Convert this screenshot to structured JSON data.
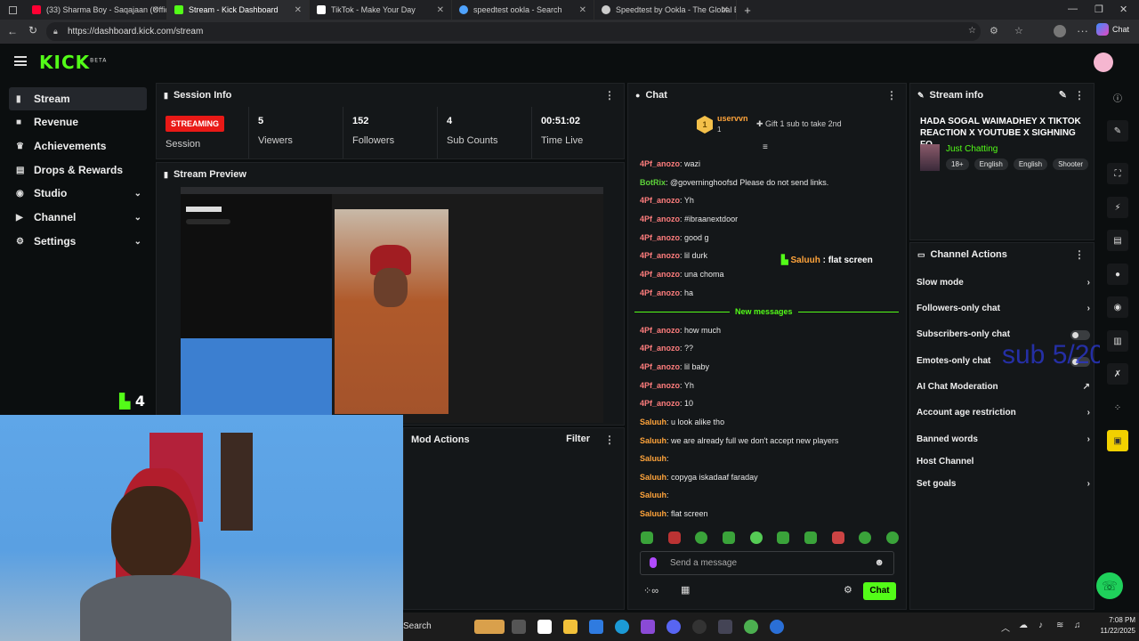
{
  "browser": {
    "tabs": [
      {
        "title": "(33) Sharma Boy - Saqajaan (Offic",
        "color": "#ff0033"
      },
      {
        "title": "Stream - Kick Dashboard",
        "color": "#53fc18"
      },
      {
        "title": "TikTok - Make Your Day",
        "color": "#ffffff"
      },
      {
        "title": "speedtest ookla - Search",
        "color": "#4fa3ff"
      },
      {
        "title": "Speedtest by Ookla - The Global B",
        "color": "#cccccc"
      }
    ],
    "url": "https://dashboard.kick.com/stream",
    "chat_button": "Chat"
  },
  "app": {
    "logo": "KICK",
    "logo_beta": "BETA"
  },
  "sidebar": {
    "items": [
      {
        "label": "Stream"
      },
      {
        "label": "Revenue"
      },
      {
        "label": "Achievements"
      },
      {
        "label": "Drops & Rewards"
      },
      {
        "label": "Studio"
      },
      {
        "label": "Channel"
      },
      {
        "label": "Settings"
      }
    ]
  },
  "session": {
    "title": "Session Info",
    "status": "STREAMING",
    "status_label": "Session",
    "stats": [
      {
        "value": "5",
        "label": "Viewers"
      },
      {
        "value": "152",
        "label": "Followers"
      },
      {
        "value": "4",
        "label": "Sub Counts"
      },
      {
        "value": "00:51:02",
        "label": "Time Live"
      }
    ]
  },
  "preview": {
    "title": "Stream Preview",
    "overlay_count": "4"
  },
  "mod": {
    "title": "Mod Actions",
    "filter": "Filter"
  },
  "chat": {
    "title": "Chat",
    "top_user": "uservvn",
    "top_user_count": "1",
    "gift_text": "Gift 1 sub to take 2nd",
    "messages": [
      {
        "user": "4Pf_anozo",
        "text": "wazi",
        "cls": "u1"
      },
      {
        "user": "BotRix",
        "text": "@governinghoofsd Please do not send links.",
        "cls": "u3"
      },
      {
        "user": "4Pf_anozo",
        "text": "Yh",
        "cls": "u1"
      },
      {
        "user": "4Pf_anozo",
        "text": "#ibraanextdoor",
        "cls": "u1"
      },
      {
        "user": "4Pf_anozo",
        "text": "good g",
        "cls": "u1"
      },
      {
        "user": "4Pf_anozo",
        "text": "lil durk",
        "cls": "u1"
      },
      {
        "user": "4Pf_anozo",
        "text": "una choma",
        "cls": "u1"
      },
      {
        "user": "4Pf_anozo",
        "text": "ha",
        "cls": "u1"
      }
    ],
    "new_messages_label": "New messages",
    "messages2": [
      {
        "user": "4Pf_anozo",
        "text": "how much",
        "cls": "u1"
      },
      {
        "user": "4Pf_anozo",
        "text": "??",
        "cls": "u1"
      },
      {
        "user": "4Pf_anozo",
        "text": "lil baby",
        "cls": "u1"
      },
      {
        "user": "4Pf_anozo",
        "text": "Yh",
        "cls": "u1"
      },
      {
        "user": "4Pf_anozo",
        "text": "10",
        "cls": "u1"
      },
      {
        "user": "Saluuh",
        "text": "u look alike tho",
        "cls": "u2"
      },
      {
        "user": "Saluuh",
        "text": "we are already full we don't accept new players",
        "cls": "u2"
      },
      {
        "user": "Saluuh",
        "text": "",
        "cls": "u2"
      },
      {
        "user": "Saluuh",
        "text": "copyga iskadaaf faraday",
        "cls": "u2"
      },
      {
        "user": "Saluuh",
        "text": "",
        "cls": "u2"
      },
      {
        "user": "Saluuh",
        "text": "flat screen",
        "cls": "u2"
      }
    ],
    "floating_user": "Saluuh",
    "floating_text": "flat screen",
    "input_placeholder": "Send a message",
    "send_label": "Chat"
  },
  "stream_info": {
    "title": "Stream info",
    "stream_title": "HADA SOGAL WAIMADHEY X TIKTOK REACTION X YOUTUBE X SIGHNING FO...",
    "category": "Just Chatting",
    "tags": [
      "18+",
      "English",
      "English",
      "Shooter"
    ]
  },
  "channel_actions": {
    "title": "Channel Actions",
    "items": [
      {
        "label": "Slow mode"
      },
      {
        "label": "Followers-only chat"
      },
      {
        "label": "Subscribers-only chat"
      },
      {
        "label": "Emotes-only chat"
      },
      {
        "label": "AI Chat Moderation"
      },
      {
        "label": "Account age restriction"
      },
      {
        "label": "Banned words"
      },
      {
        "label": "Host Channel"
      },
      {
        "label": "Set goals"
      }
    ],
    "overlay_text": "sub 5/20"
  },
  "taskbar": {
    "search": "Search",
    "time": "7:08 PM",
    "date": "11/22/2025"
  },
  "colors": {
    "accent": "#53fc18",
    "streaming": "#e91916"
  }
}
